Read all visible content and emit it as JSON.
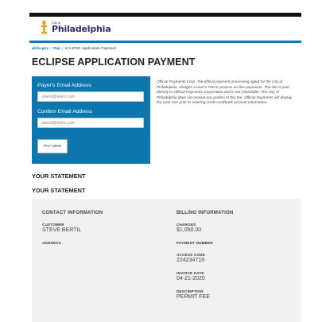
{
  "header": {
    "logo_small": "City of",
    "logo_big": "Philadelphia"
  },
  "breadcrumb": {
    "home": "phila.gov",
    "sep1": "/",
    "pay": "Pay",
    "sep2": "/",
    "current": "eCLIPSE Application Payment"
  },
  "page_title": "ECLIPSE APPLICATION PAYMENT",
  "payment_form": {
    "payer_email_label": "Payer's Email Address",
    "payer_email_value": "sbertil@klehr.com",
    "confirm_email_label": "Confirm Email Address",
    "confirm_email_value": "sbertil@klehr.com",
    "pay_button": "PAY NOW"
  },
  "disclaimer": "Official Payments Corp., the official payment processing agent for the City of Philadelphia, charges a User's Fee to process on-line payments. This fee is paid directly to Official Payments Corporation and is not refundable. The City of Philadelphia does not receive any portion of this fee. Official Payments will display the User Fee prior to entering credit card/bank account information.",
  "statement": {
    "heading_1": "YOUR STATEMENT",
    "heading_2": "YOUR STATEMENT",
    "contact": {
      "title": "CONTACT INFORMATION",
      "customer_label": "CUSTOMER",
      "customer_value": "STEVE BERTIL",
      "address_label": "ADDRESS"
    },
    "billing": {
      "title": "BILLING INFORMATION",
      "charges_label": "CHARGES",
      "charges_value": "$1,050.00",
      "payment_number_label": "PAYMENT NUMBER",
      "access_code_label": "ACCESS CODE",
      "access_code_value": "224234719",
      "invoice_date_label": "INVOICE DATE",
      "invoice_date_value": "04-21-2020",
      "description_label": "DESCRIPTION",
      "description_value": "PERMIT FEE"
    }
  },
  "colors": {
    "brand_blue": "#0c76ad",
    "strip_blue": "#0b79b8",
    "logo_gold": "#e2a21a",
    "logo_navy": "#2f2f6b"
  }
}
